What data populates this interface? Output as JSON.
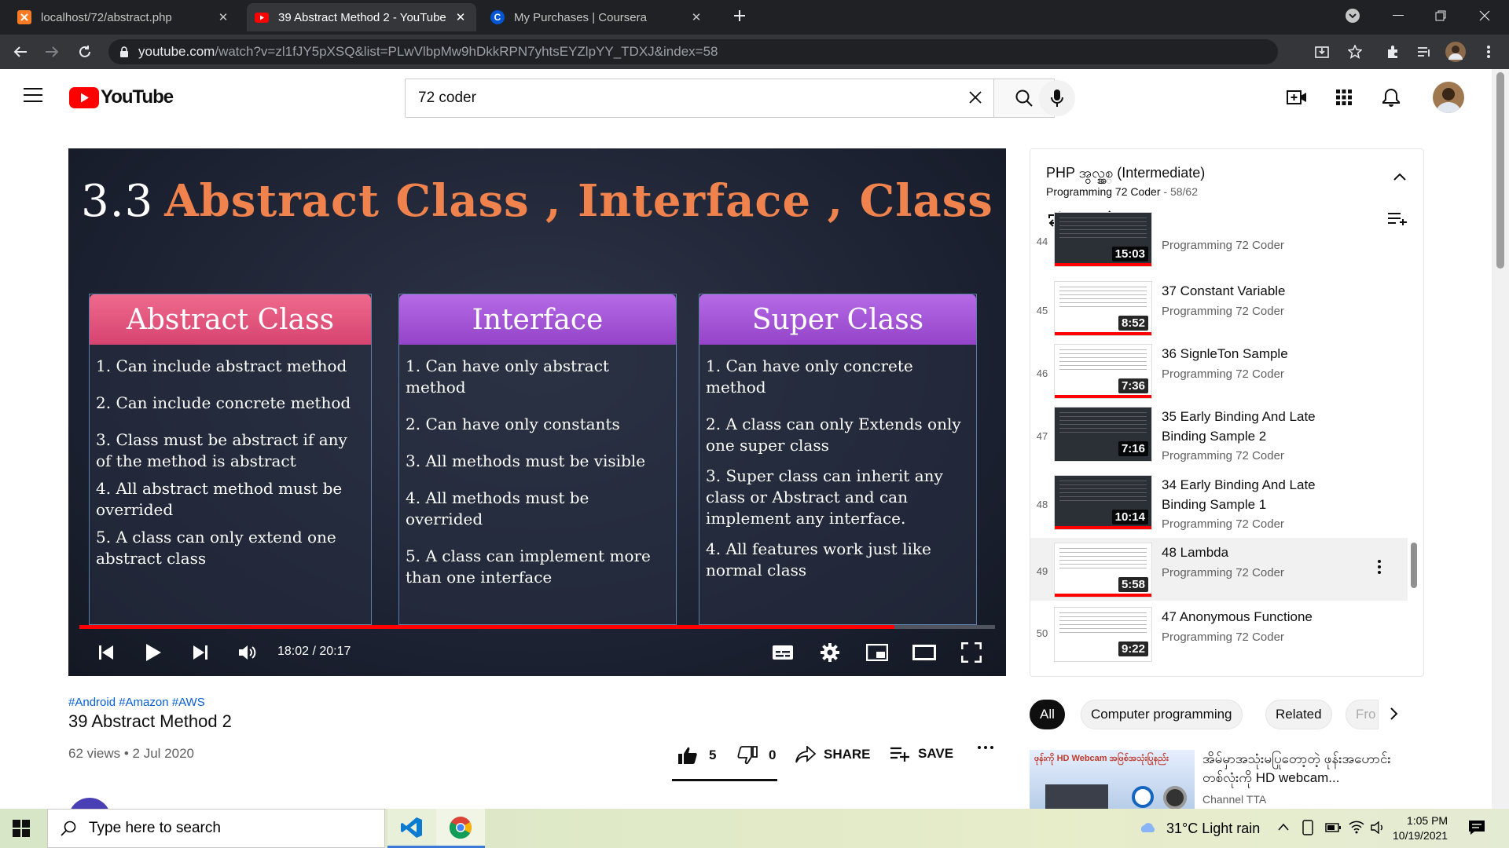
{
  "browser": {
    "tabs": [
      {
        "title": "localhost/72/abstract.php",
        "active": false
      },
      {
        "title": "39 Abstract Method 2 - YouTube",
        "active": true
      },
      {
        "title": "My Purchases | Coursera",
        "active": false
      }
    ],
    "url_domain": "youtube.com",
    "url_path": "/watch?v=zl1fJY5pXSQ&list=PLwVlbpMw9hDkkRPN7yhtsEYZlpYY_TDXJ&index=58"
  },
  "youtube": {
    "logo_text": "YouTube",
    "search_value": "72 coder"
  },
  "slide": {
    "title_num": "3.3",
    "title_text": "Abstract Class , Interface , Class",
    "cards": [
      {
        "header": "Abstract Class",
        "items": [
          "1.  Can include abstract method",
          "2.  Can include concrete method",
          "3.  Class must be abstract if any of the method is abstract",
          "4. All abstract method must be overrided",
          "5. A class can only extend one abstract class"
        ]
      },
      {
        "header": "Interface",
        "items": [
          "1.  Can have only abstract method",
          "2.  Can have only constants",
          "3.  All methods must be visible",
          "4.  All methods must be overrided",
          "5.   A class can implement more than  one interface"
        ]
      },
      {
        "header": "Super Class",
        "items": [
          "1.  Can have only concrete method",
          "2.  A class can only Extends only one super class",
          "3.  Super class can inherit any class or Abstract and  can implement any interface.",
          "4.  All features work just like normal class"
        ]
      }
    ]
  },
  "player": {
    "time": "18:02 / 20:17",
    "progress_fraction": 0.89
  },
  "video": {
    "hashtags": "#Android #Amazon #AWS",
    "title": "39 Abstract Method 2",
    "views": "62 views • 2 Jul 2020",
    "likes": "5",
    "dislikes": "0",
    "share_label": "SHARE",
    "save_label": "SAVE"
  },
  "playlist": {
    "title": "PHP အွလ္ပ္အစ္ (Intermediate)",
    "channel": "Programming 72 Coder",
    "position": " - 58/62",
    "items": [
      {
        "index": "44",
        "title": "",
        "channel": "Programming 72 Coder",
        "duration": "15:03"
      },
      {
        "index": "45",
        "title": "37 Constant Variable",
        "channel": "Programming 72 Coder",
        "duration": "8:52"
      },
      {
        "index": "46",
        "title": "36 SignleTon Sample",
        "channel": "Programming 72 Coder",
        "duration": "7:36"
      },
      {
        "index": "47",
        "title": "35 Early Binding And Late Binding Sample 2",
        "channel": "Programming 72 Coder",
        "duration": "7:16"
      },
      {
        "index": "48",
        "title": "34 Early Binding And Late Binding Sample 1",
        "channel": "Programming 72 Coder",
        "duration": "10:14"
      },
      {
        "index": "49",
        "title": "48 Lambda",
        "channel": "Programming 72 Coder",
        "duration": "5:58"
      },
      {
        "index": "50",
        "title": "47 Anonymous Functione",
        "channel": "Programming 72 Coder",
        "duration": "9:22"
      }
    ]
  },
  "chips": [
    "All",
    "Computer programming",
    "Related",
    "Fro"
  ],
  "recommended": {
    "title": "အိမ်မှာအသုံးမပြုတော့တဲ့ ဖုန်းအဟောင်းတစ်လုံးကို HD webcam...",
    "channel": "Channel TTA",
    "thumb_text": "ဖုန်းကို HD Webcam အဖြစ်အသုံးပြုနည်း"
  },
  "taskbar": {
    "search_placeholder": "Type here to search",
    "weather": "31°C  Light rain",
    "time": "1:05 PM",
    "date": "10/19/2021"
  },
  "colors": {
    "youtube_red": "#ff0000",
    "slide_accent": "#f0834d",
    "abstract_header": "#e0557a",
    "interface_header": "#a453d6",
    "superclass_header": "#a453d6"
  }
}
